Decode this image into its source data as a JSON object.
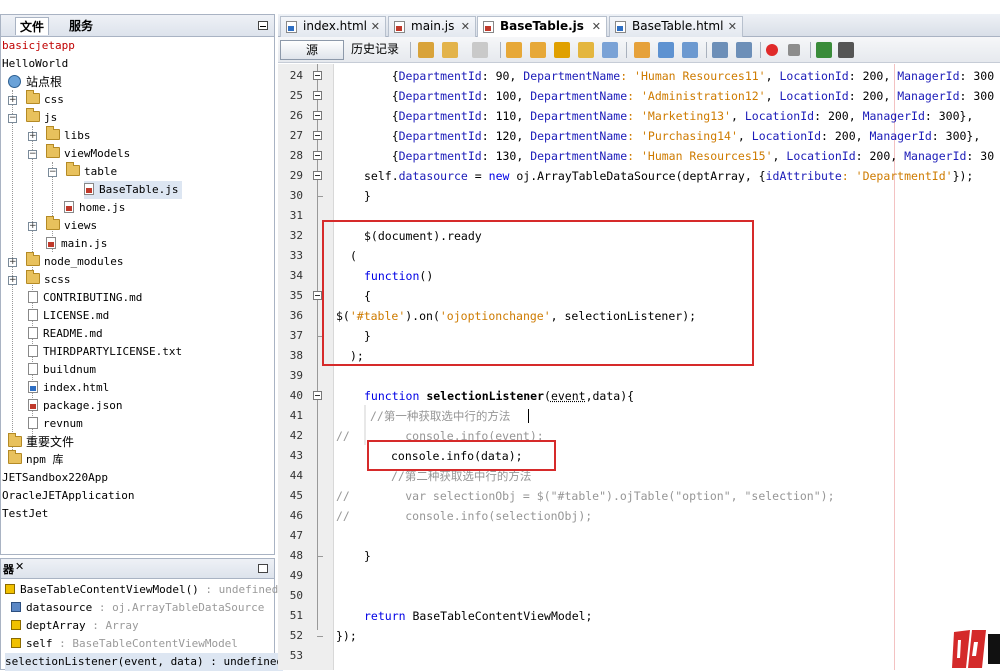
{
  "left_panel": {
    "tabs": [
      "文件",
      "服务"
    ],
    "tree": [
      {
        "label": "basicjetapp",
        "color": "#c00000"
      },
      {
        "label": "HelloWorld"
      },
      {
        "label": "站点根"
      },
      {
        "label": "css"
      },
      {
        "label": "js"
      },
      {
        "label": "libs"
      },
      {
        "label": "viewModels"
      },
      {
        "label": "table"
      },
      {
        "label": "BaseTable.js"
      },
      {
        "label": "home.js"
      },
      {
        "label": "views"
      },
      {
        "label": "main.js"
      },
      {
        "label": "node_modules"
      },
      {
        "label": "scss"
      },
      {
        "label": "CONTRIBUTING.md"
      },
      {
        "label": "LICENSE.md"
      },
      {
        "label": "README.md"
      },
      {
        "label": "THIRDPARTYLICENSE.txt"
      },
      {
        "label": "buildnum"
      },
      {
        "label": "index.html"
      },
      {
        "label": "package.json"
      },
      {
        "label": "revnum"
      },
      {
        "label": "重要文件"
      },
      {
        "label": "npm 库"
      },
      {
        "label": "JETSandbox220App"
      },
      {
        "label": "OracleJETApplication"
      },
      {
        "label": "TestJet"
      }
    ]
  },
  "navigator": {
    "tab": "器",
    "items": [
      {
        "name": "BaseTableContentViewModel()",
        "type": " : undefined"
      },
      {
        "name": "datasource",
        "type": " : oj.ArrayTableDataSource"
      },
      {
        "name": "deptArray",
        "type": " : Array"
      },
      {
        "name": "self",
        "type": " : BaseTableContentViewModel"
      },
      {
        "name": "selectionListener(event, data)",
        "type": " : undefined"
      }
    ]
  },
  "editor_tabs": [
    {
      "label": "index.html",
      "icon": "html-file-icon"
    },
    {
      "label": "main.js",
      "icon": "js-file-icon"
    },
    {
      "label": "BaseTable.js",
      "icon": "js-file-icon",
      "active": true
    },
    {
      "label": "BaseTable.html",
      "icon": "html-file-icon"
    }
  ],
  "toolbar": {
    "source_label": "源",
    "history_label": "历史记录"
  },
  "line_numbers": [
    "24",
    "25",
    "26",
    "27",
    "28",
    "29",
    "30",
    "31",
    "32",
    "33",
    "34",
    "35",
    "36",
    "37",
    "38",
    "39",
    "40",
    "41",
    "42",
    "43",
    "44",
    "45",
    "46",
    "47",
    "48",
    "49",
    "50",
    "51",
    "52",
    "53"
  ],
  "code": {
    "l24": {
      "pre": "    {",
      "k1": "DepartmentId",
      "v1": ": 90, ",
      "k2": "DepartmentName",
      "s": ": 'Human Resources11'",
      "rest": ", ",
      "k3": "LocationId",
      "v3": ": 200, ",
      "k4": "ManagerId",
      "v4": ": 300"
    },
    "l25": {
      "pre": "    {",
      "k1": "DepartmentId",
      "v1": ": 100, ",
      "k2": "DepartmentName",
      "s": ": 'Administration12'",
      "rest": ", ",
      "k3": "LocationId",
      "v3": ": 200, ",
      "k4": "ManagerId",
      "v4": ": 300"
    },
    "l26": {
      "pre": "    {",
      "k1": "DepartmentId",
      "v1": ": 110, ",
      "k2": "DepartmentName",
      "s": ": 'Marketing13'",
      "rest": ", ",
      "k3": "LocationId",
      "v3": ": 200, ",
      "k4": "ManagerId",
      "v4": ": 300},"
    },
    "l27": {
      "pre": "    {",
      "k1": "DepartmentId",
      "v1": ": 120, ",
      "k2": "DepartmentName",
      "s": ": 'Purchasing14'",
      "rest": ", ",
      "k3": "LocationId",
      "v3": ": 200, ",
      "k4": "ManagerId",
      "v4": ": 300},"
    },
    "l28": {
      "pre": "    {",
      "k1": "DepartmentId",
      "v1": ": 130, ",
      "k2": "DepartmentName",
      "s": ": 'Human Resources15'",
      "rest": ", ",
      "k3": "LocationId",
      "v3": ": 200, ",
      "k4": "ManagerId",
      "v4": ": 30"
    },
    "l29": {
      "a": "self.",
      "b": "datasource",
      "c": " = ",
      "d": "new",
      "e": " oj.ArrayTableDataSource(deptArray, {",
      "f": "idAttribute",
      "g": ": 'DepartmentId'",
      "h": "});"
    },
    "l30": "}",
    "l32": "$(document).ready",
    "l33": "(",
    "l34a": "function",
    "l34b": "()",
    "l35": "{",
    "l36a": "$(",
    "l36b": "'#table'",
    "l36c": ").on(",
    "l36d": "'ojoptionchange'",
    "l36e": ", selectionListener);",
    "l37": "}",
    "l38": ");",
    "l40a": "function",
    "l40b": " selectionListener",
    "l40c": "(",
    "l40d": "event",
    "l40e": ",data){",
    "l41": "//第一种获取选中行的方法",
    "l42": "//        console.info(event);",
    "l43": "console.info(data);",
    "l44": "//第二种获取选中行的方法",
    "l45": "//        var selectionObj = $(\"#table\").ojTable(\"option\", \"selection\");",
    "l46": "//        console.info(selectionObj);",
    "l48": "}",
    "l51a": "return",
    "l51b": " BaseTableContentViewModel;",
    "l52": "});"
  }
}
